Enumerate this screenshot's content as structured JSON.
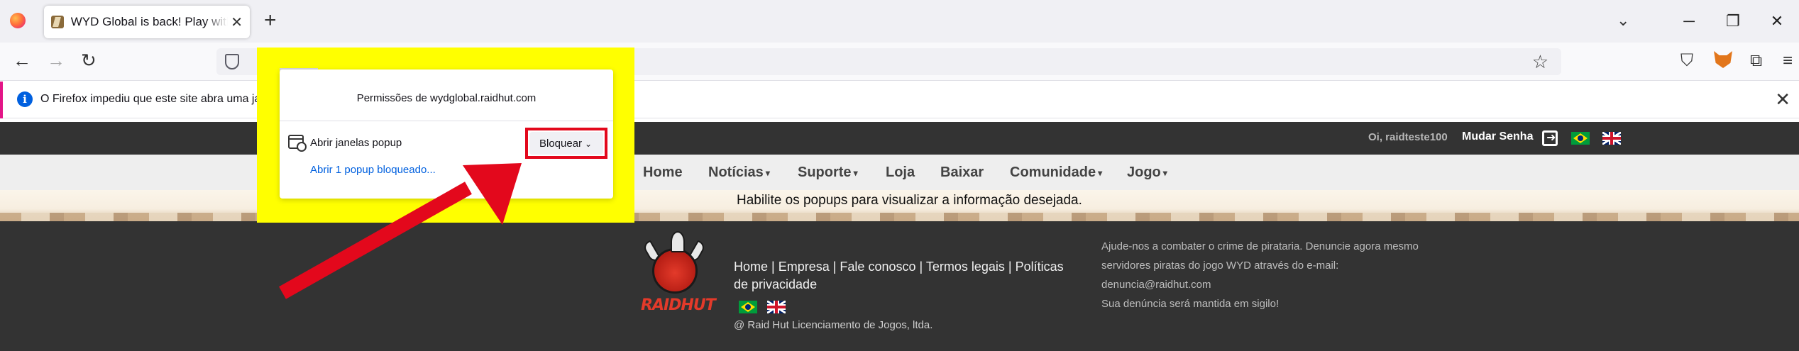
{
  "browser": {
    "tab": {
      "title": "WYD Global is back! Play with y",
      "close": "✕"
    },
    "new_tab": "+",
    "list_all_tabs": "⌄",
    "window_controls": {
      "minimize": "─",
      "restore": "❐",
      "close": "✕"
    },
    "nav": {
      "back": "←",
      "forward": "→",
      "reload": "↻",
      "bookmark": "☆",
      "pocket": "⛉",
      "extensions": "⧉",
      "menu": "≡"
    }
  },
  "notification": {
    "icon": "i",
    "text": "O Firefox impediu que este site abra uma ja",
    "close": "✕"
  },
  "permission_popup": {
    "title": "Permissões de wydglobal.raidhut.com",
    "label": "Abrir janelas popup",
    "link": "Abrir 1 popup bloqueado...",
    "select_value": "Bloquear",
    "chevron": "⌄"
  },
  "site": {
    "topbar": {
      "greeting": "Oi, raidteste100",
      "change_password": "Mudar Senha"
    },
    "nav": {
      "home": "Home",
      "noticias": "Notícias",
      "suporte": "Suporte",
      "loja": "Loja",
      "baixar": "Baixar",
      "comunidade": "Comunidade",
      "jogo": "Jogo",
      "caret": "▾"
    },
    "banner_message": "Habilite os popups para visualizar a informação desejada.",
    "footer": {
      "logo_word_a": "RAID",
      "logo_word_b": "HUT",
      "links": {
        "home": "Home",
        "empresa": "Empresa",
        "fale": "Fale conosco",
        "termos": "Termos legais",
        "politicas": "Políticas de privacidade",
        "sep": " | "
      },
      "copyright": "@ Raid Hut Licenciamento de Jogos, ltda.",
      "piracy": {
        "line1": "Ajude-nos a combater o crime de pirataria. Denuncie agora mesmo",
        "line2": "servidores piratas do jogo WYD através do e-mail:",
        "email": "denuncia@raidhut.com",
        "line4": "Sua denúncia será mantida em sigilo!"
      }
    }
  },
  "colors": {
    "highlight": "#ffff00",
    "annotation_red": "#e3081c",
    "site_dark": "#333333",
    "link_blue": "#0060df"
  }
}
